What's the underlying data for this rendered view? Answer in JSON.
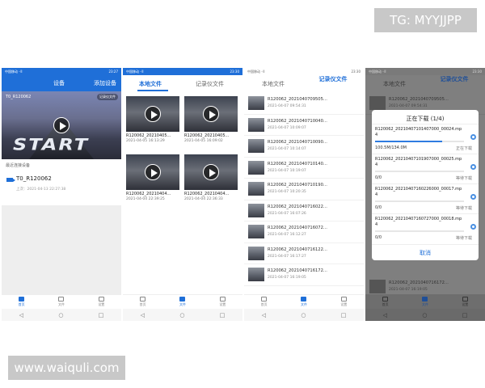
{
  "watermarks": {
    "top": "TG: MYYJJPP",
    "bottom": "www.waiquli.com"
  },
  "status_bar": {
    "left": "中国移动 ᐧᐧll",
    "right_1": "23:27",
    "right_2": "23:30"
  },
  "nav": {
    "home": "首页",
    "files": "文件",
    "settings": "设置"
  },
  "sysnav": {
    "back": "◁",
    "home": "○",
    "recent": "□"
  },
  "tabs": {
    "local": "本地文件",
    "recorder": "记录仪文件"
  },
  "devices_screen": {
    "title": "设备",
    "add_button": "添加设备",
    "hero_device": "T0_R120062",
    "hero_badge": "记录仪文件",
    "hero_text": "START",
    "recent_label": "最近连接设备",
    "device_name": "T0_R120062",
    "device_last": "上次：2021-04-13 22:27:38"
  },
  "local_files": [
    {
      "name": "R120062_20210405...",
      "date": "2021-04-05 16:13:29"
    },
    {
      "name": "R120062_20210405...",
      "date": "2021-04-05 16:09:02"
    },
    {
      "name": "R120062_20210404...",
      "date": "2021-04-04 22:39:25"
    },
    {
      "name": "R120062_20210404...",
      "date": "2021-04-04 22:36:33"
    }
  ],
  "recorder_files": [
    {
      "name": "R120062_2021040709505...",
      "date": "2021-04-07 09:54:31"
    },
    {
      "name": "R120062_2021040710040...",
      "date": "2021-04-07 10:09:07"
    },
    {
      "name": "R120062_2021040710090...",
      "date": "2021-04-07 10:14:07"
    },
    {
      "name": "R120062_2021040710140...",
      "date": "2021-04-07 10:19:07"
    },
    {
      "name": "R120062_2021040710190...",
      "date": "2021-04-07 10:20:35"
    },
    {
      "name": "R120062_2021040716022...",
      "date": "2021-04-07 16:07:26"
    },
    {
      "name": "R120062_2021040716072...",
      "date": "2021-04-07 16:12:27"
    },
    {
      "name": "R120062_2021040716122...",
      "date": "2021-04-07 16:17:27"
    },
    {
      "name": "R120062_2021040716172...",
      "date": "2021-04-07 16:19:05"
    }
  ],
  "download_dialog": {
    "title": "正在下载 (1/4)",
    "cancel": "取消",
    "items": [
      {
        "name": "R120062_20210407101407000_00024.mp4",
        "info": "100.5M/134.0M",
        "status": "正在下载",
        "progress": 0.75
      },
      {
        "name": "R120062_20210407101907000_00025.mp4",
        "info": "0/0",
        "status": "等待下载",
        "progress": 0
      },
      {
        "name": "R120062_20210407160226000_00017.mp4",
        "info": "0/0",
        "status": "等待下载",
        "progress": 0
      },
      {
        "name": "R120062_20210407160727000_00018.mp4",
        "info": "0/0",
        "status": "等待下载",
        "progress": 0
      }
    ]
  },
  "colors": {
    "accent": "#1f6fd8",
    "overlay": "#7f7f7f"
  }
}
